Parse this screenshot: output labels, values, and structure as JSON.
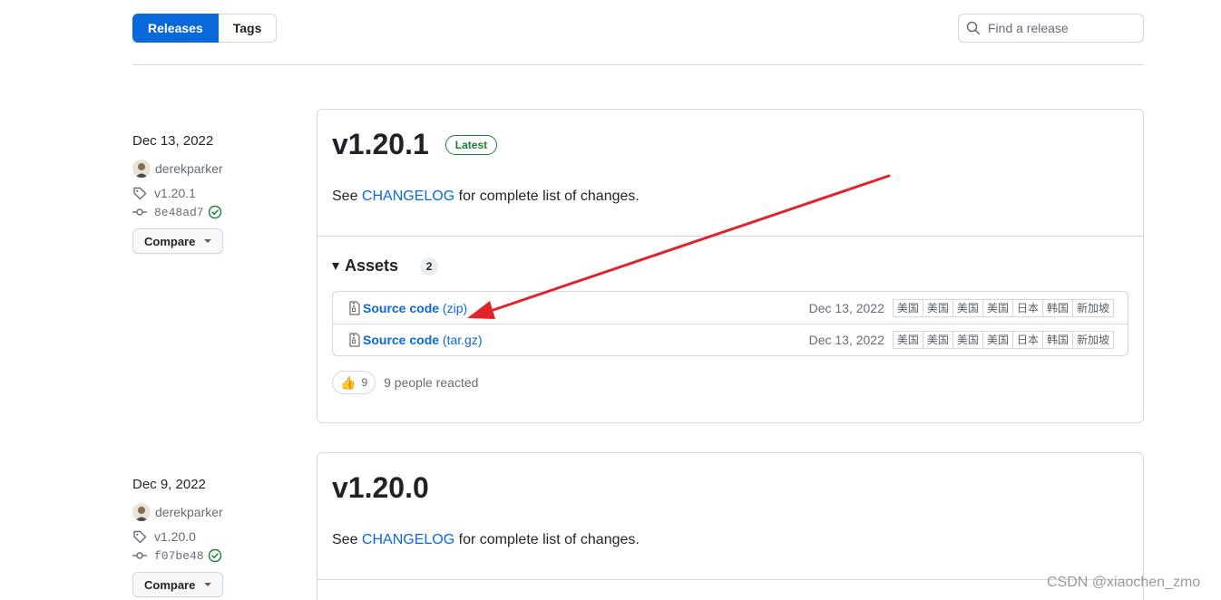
{
  "subnav": {
    "releases_label": "Releases",
    "tags_label": "Tags"
  },
  "search": {
    "placeholder": "Find a release"
  },
  "releases": [
    {
      "date": "Dec 13, 2022",
      "author": "derekparker",
      "tag": "v1.20.1",
      "commit": "8e48ad7",
      "compare_label": "Compare",
      "title": "v1.20.1",
      "latest_badge": "Latest",
      "desc_prefix": "See ",
      "desc_link": "CHANGELOG",
      "desc_suffix": " for complete list of changes.",
      "assets_label": "Assets",
      "assets_count": "2",
      "assets": [
        {
          "name": "Source code",
          "ext": "(zip)",
          "date": "Dec 13, 2022"
        },
        {
          "name": "Source code",
          "ext": "(tar.gz)",
          "date": "Dec 13, 2022"
        }
      ],
      "reaction_emoji": "👍",
      "reaction_count": "9",
      "reaction_text": "9 people reacted"
    },
    {
      "date": "Dec 9, 2022",
      "author": "derekparker",
      "tag": "v1.20.0",
      "commit": "f07be48",
      "compare_label": "Compare",
      "title": "v1.20.0",
      "desc_prefix": "See ",
      "desc_link": "CHANGELOG",
      "desc_suffix": " for complete list of changes."
    }
  ],
  "mirrors": [
    "美国",
    "美国",
    "美国",
    "美国",
    "日本",
    "韩国",
    "新加坡"
  ],
  "annotation": {
    "arrow_color": "#e0242b"
  },
  "colors": {
    "accent": "#0969da",
    "latest_green": "#1a7f37",
    "border": "#d0d7de"
  },
  "watermark": "CSDN @xiaochen_zmo"
}
